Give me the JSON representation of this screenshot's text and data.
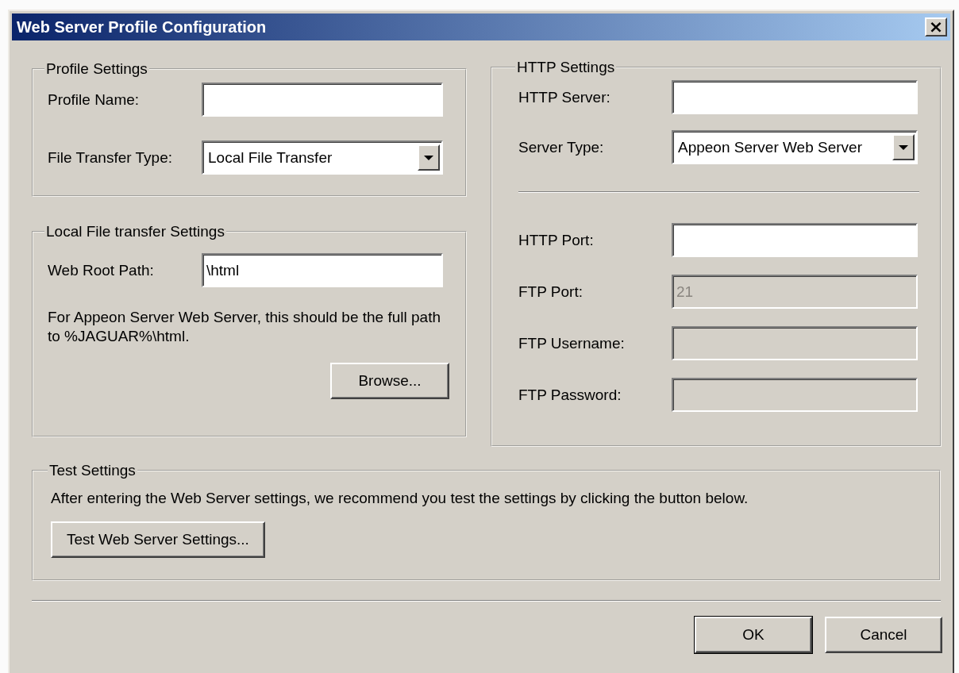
{
  "window": {
    "title": "Web Server Profile Configuration",
    "close": "×"
  },
  "profile_settings": {
    "title": "Profile Settings",
    "fields": [
      {
        "kind": "text",
        "label": "Profile Name:",
        "disabled": false
      },
      {
        "kind": "dropdown",
        "label": "File Transfer Type:",
        "value": "Local File Transfer",
        "disabled": false
      }
    ]
  },
  "local_settings": {
    "title": "Local File transfer Settings",
    "fields": [
      {
        "kind": "text",
        "label": "Web Root Path:",
        "value": "\\html",
        "disabled": false
      }
    ],
    "note": "For Appeon Server Web Server, this should be the full path to %JAGUAR%\\html.",
    "button": "Browse..."
  },
  "http_settings": {
    "title": "HTTP Settings",
    "server_fields": [
      {
        "kind": "text",
        "label": "HTTP Server:",
        "disabled": false
      },
      {
        "kind": "dropdown",
        "label": "Server Type:",
        "value": "Appeon Server Web Server",
        "disabled": false
      }
    ],
    "port_fields": [
      {
        "kind": "text",
        "label": "HTTP Port:",
        "disabled": false
      },
      {
        "kind": "text",
        "label": "FTP Port:",
        "value": "21",
        "disabled": true
      },
      {
        "kind": "text",
        "label": "FTP Username:",
        "disabled": true
      },
      {
        "kind": "text",
        "label": "FTP Password:",
        "disabled": true
      }
    ]
  },
  "test_settings": {
    "title": "Test Settings",
    "note": "After entering the Web Server settings, we recommend you test the settings by clicking the button below.",
    "button": "Test Web Server Settings..."
  },
  "buttons": [
    {
      "label": "OK",
      "default": true
    },
    {
      "label": "Cancel",
      "default": false
    }
  ]
}
